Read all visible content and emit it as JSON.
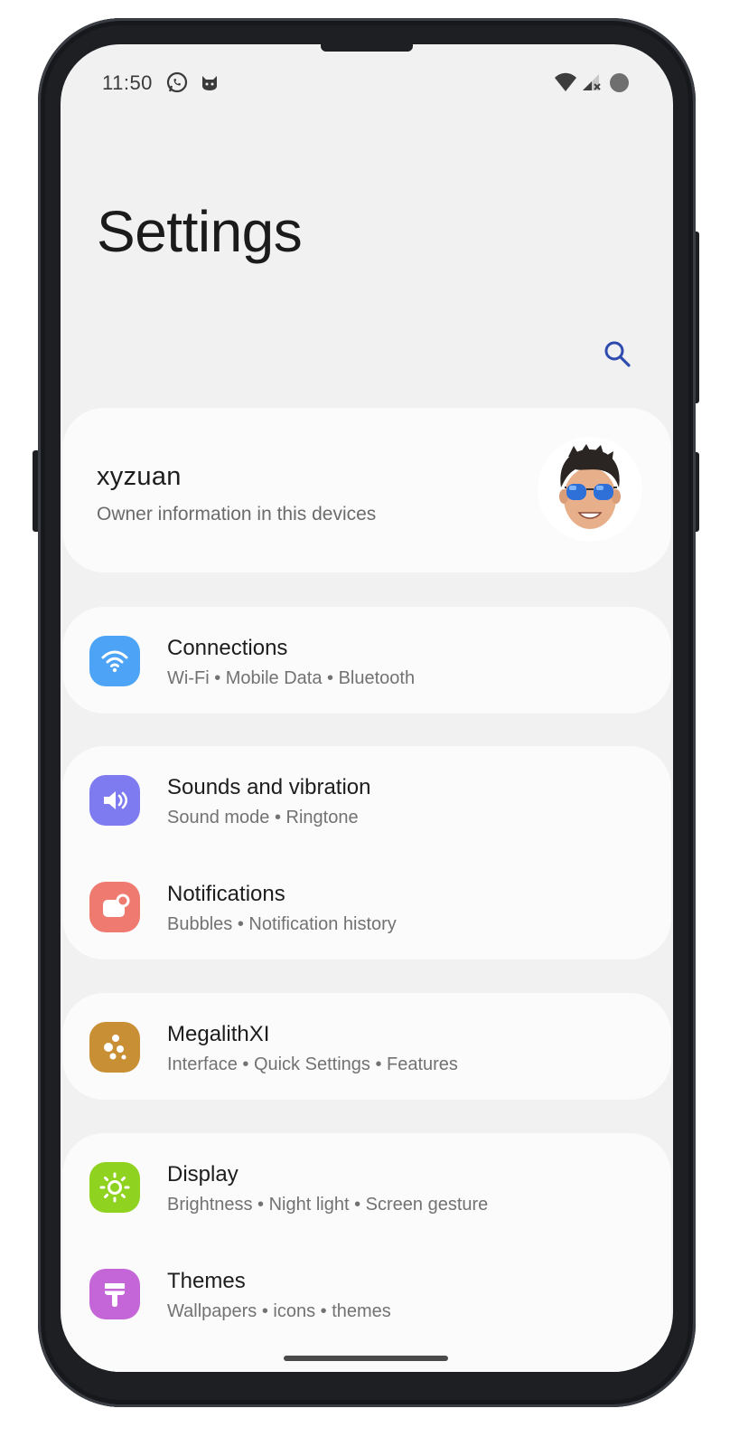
{
  "status_bar": {
    "time": "11:50",
    "notification_icons": [
      "whatsapp-icon",
      "cat-icon"
    ],
    "system_icons": [
      "wifi-icon",
      "signal-icon",
      "battery-icon"
    ]
  },
  "header": {
    "title": "Settings",
    "search_icon": "search-icon"
  },
  "profile": {
    "name": "xyzuan",
    "subtitle": "Owner information in this devices",
    "avatar_icon": "memoji-avatar"
  },
  "groups": [
    {
      "items": [
        {
          "key": "connections",
          "title": "Connections",
          "subtitle": "Wi-Fi • Mobile Data • Bluetooth",
          "icon": "wifi-icon",
          "color": "#4da3f5"
        }
      ]
    },
    {
      "items": [
        {
          "key": "sounds",
          "title": "Sounds and vibration",
          "subtitle": "Sound mode • Ringtone",
          "icon": "speaker-icon",
          "color": "#7e7af0"
        },
        {
          "key": "notifications",
          "title": "Notifications",
          "subtitle": "Bubbles • Notification history",
          "icon": "notification-icon",
          "color": "#ef7b70"
        }
      ]
    },
    {
      "items": [
        {
          "key": "megalith",
          "title": "MegalithXI",
          "subtitle": "Interface • Quick Settings • Features",
          "icon": "megalith-icon",
          "color": "#c98f35"
        }
      ]
    },
    {
      "items": [
        {
          "key": "display",
          "title": "Display",
          "subtitle": "Brightness • Night light • Screen gesture",
          "icon": "sun-icon",
          "color": "#8fd21f"
        },
        {
          "key": "themes",
          "title": "Themes",
          "subtitle": "Wallpapers • icons • themes",
          "icon": "brush-icon",
          "color": "#c466d8"
        }
      ]
    }
  ],
  "colors": {
    "screen_background": "#f1f1f1",
    "card_background": "#fbfbfb",
    "search_icon": "#2f4bb0"
  }
}
